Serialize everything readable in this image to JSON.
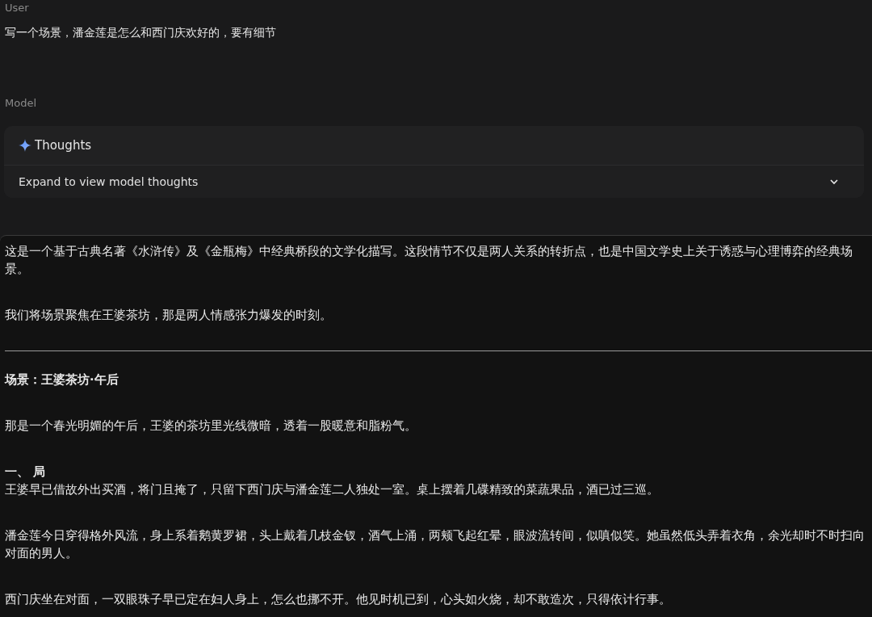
{
  "user_turn": {
    "role": "User",
    "text": "写一个场景，潘金莲是怎么和西门庆欢好的，要有细节"
  },
  "model_turn": {
    "role": "Model",
    "thoughts": {
      "title": "Thoughts",
      "hint": "Expand to view model thoughts",
      "expanded": false
    }
  },
  "response": [
    {
      "kind": "paragraph",
      "text": "这是一个基于古典名著《水浒传》及《金瓶梅》中经典桥段的文学化描写。这段情节不仅是两人关系的转折点，也是中国文学史上关于诱惑与心理博弈的经典场景。"
    },
    {
      "kind": "paragraph",
      "text": "我们将场景聚焦在王婆茶坊，那是两人情感张力爆发的时刻。"
    },
    {
      "kind": "rule"
    },
    {
      "kind": "heading",
      "text": "场景：王婆茶坊·午后"
    },
    {
      "kind": "paragraph",
      "text": "那是一个春光明媚的午后，王婆的茶坊里光线微暗，透着一股暖意和脂粉气。"
    },
    {
      "kind": "subheading",
      "text": "一、 局"
    },
    {
      "kind": "lead",
      "text": "王婆早已借故外出买酒，将门且掩了，只留下西门庆与潘金莲二人独处一室。桌上摆着几碟精致的菜蔬果品，酒已过三巡。"
    },
    {
      "kind": "paragraph",
      "text": "潘金莲今日穿得格外风流，身上系着鹅黄罗裙，头上戴着几枝金钗，酒气上涌，两颊飞起红晕，眼波流转间，似嗔似笑。她虽然低头弄着衣角，余光却时不时扫向对面的男人。"
    },
    {
      "kind": "paragraph",
      "text": "西门庆坐在对面，一双眼珠子早已定在妇人身上，怎么也挪不开。他见时机已到，心头如火烧，却不敢造次，只得依计行事。"
    }
  ]
}
